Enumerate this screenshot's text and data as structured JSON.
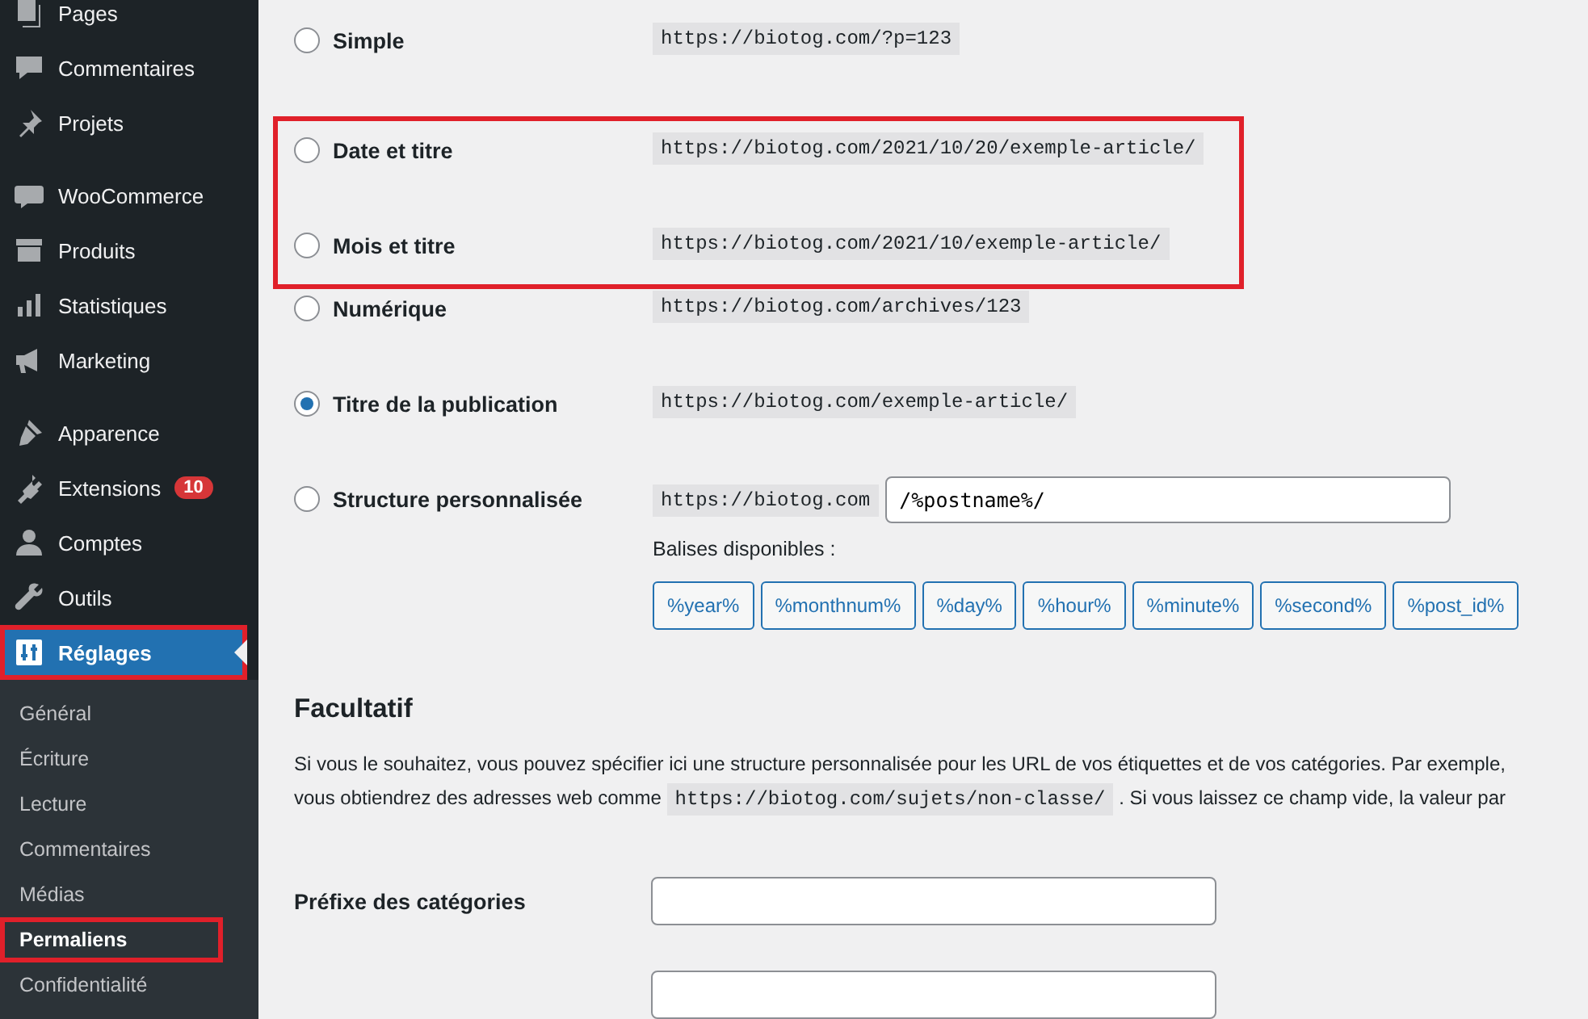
{
  "sidebar": {
    "groups": [
      {
        "items": [
          {
            "label": "Pages",
            "selected": false,
            "highlighted": false
          },
          {
            "label": "Commentaires",
            "selected": false,
            "highlighted": false
          },
          {
            "label": "Projets",
            "selected": false,
            "highlighted": false
          }
        ]
      },
      {
        "items": [
          {
            "label": "WooCommerce",
            "selected": false,
            "highlighted": false
          },
          {
            "label": "Produits",
            "selected": false,
            "highlighted": false
          },
          {
            "label": "Statistiques",
            "selected": false,
            "highlighted": false
          },
          {
            "label": "Marketing",
            "selected": false,
            "highlighted": false
          }
        ]
      },
      {
        "items": [
          {
            "label": "Apparence",
            "selected": false,
            "highlighted": false
          },
          {
            "label": "Extensions",
            "badge": "10",
            "selected": false,
            "highlighted": false
          },
          {
            "label": "Comptes",
            "selected": false,
            "highlighted": false
          },
          {
            "label": "Outils",
            "selected": false,
            "highlighted": false
          },
          {
            "label": "Réglages",
            "selected": true,
            "highlighted": true,
            "submenu": [
              {
                "label": "Général",
                "selected": false,
                "highlighted": false
              },
              {
                "label": "Écriture",
                "selected": false,
                "highlighted": false
              },
              {
                "label": "Lecture",
                "selected": false,
                "highlighted": false
              },
              {
                "label": "Commentaires",
                "selected": false,
                "highlighted": false
              },
              {
                "label": "Médias",
                "selected": false,
                "highlighted": false
              },
              {
                "label": "Permaliens",
                "selected": true,
                "highlighted": true
              },
              {
                "label": "Confidentialité",
                "selected": false,
                "highlighted": false
              }
            ]
          }
        ]
      }
    ]
  },
  "permalink_options": [
    {
      "kind": "example",
      "label": "Simple",
      "example": "https://biotog.com/?p=123",
      "selected": false,
      "highlighted": false
    },
    {
      "kind": "example",
      "label": "Date et titre",
      "example": "https://biotog.com/2021/10/20/exemple-article/",
      "selected": false,
      "highlighted": true
    },
    {
      "kind": "example",
      "label": "Mois et titre",
      "example": "https://biotog.com/2021/10/exemple-article/",
      "selected": false,
      "highlighted": true
    },
    {
      "kind": "example",
      "label": "Numérique",
      "example": "https://biotog.com/archives/123",
      "selected": false,
      "highlighted": false
    },
    {
      "kind": "example",
      "label": "Titre de la publication",
      "example": "https://biotog.com/exemple-article/",
      "selected": true,
      "highlighted": false
    },
    {
      "kind": "custom",
      "label": "Structure personnalisée",
      "example": "https://biotog.com",
      "value": "/%postname%/",
      "selected": false,
      "highlighted": false,
      "tags_label": "Balises disponibles :",
      "tags": [
        "%year%",
        "%monthnum%",
        "%day%",
        "%hour%",
        "%minute%",
        "%second%",
        "%post_id%"
      ]
    }
  ],
  "optional": {
    "title": "Facultatif",
    "line_1": "Si vous le souhaitez, vous pouvez spécifier ici une structure personnalisée pour les URL de vos étiquettes et de vos catégories. Par exemple,",
    "line_2_before": "vous obtiendrez des adresses web comme",
    "line_2_code": "https://biotog.com/sujets/non-classe/",
    "line_2_after": ". Si vous laissez ce champ vide, la valeur par",
    "fields": [
      {
        "label": "Préfixe des catégories"
      }
    ]
  }
}
